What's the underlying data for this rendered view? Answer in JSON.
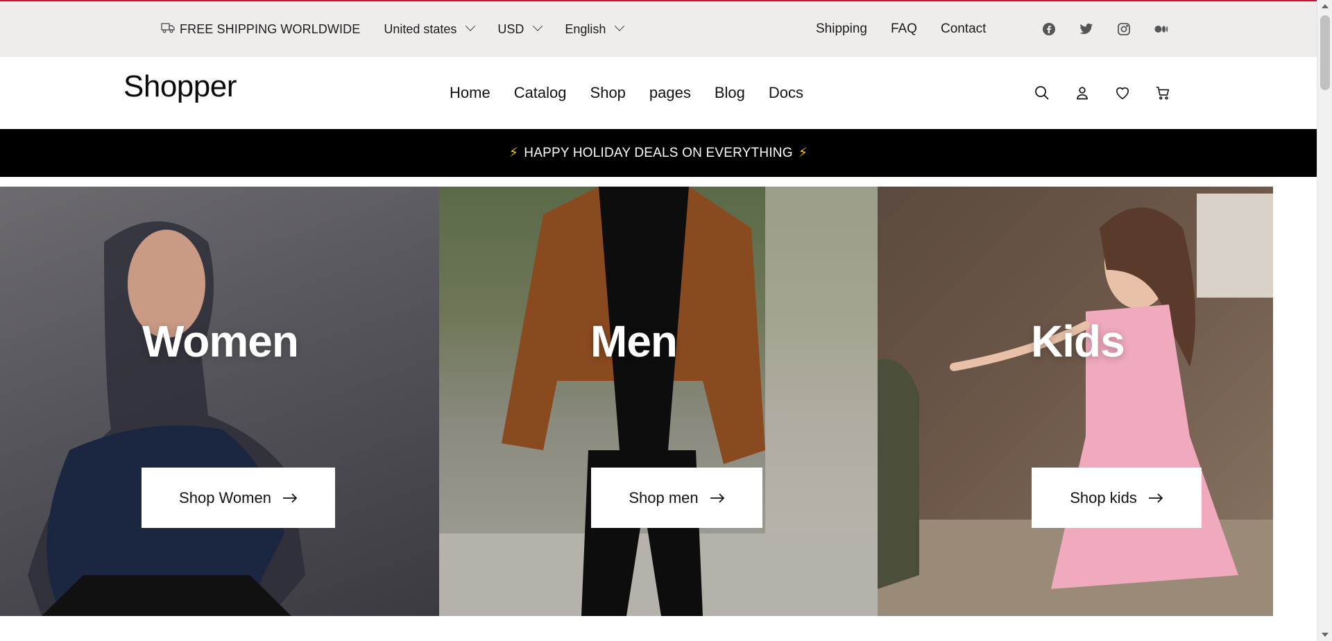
{
  "topbar": {
    "shipping_text": "FREE SHIPPING WORLDWIDE",
    "country": "United states",
    "currency": "USD",
    "language": "English",
    "links": [
      "Shipping",
      "FAQ",
      "Contact"
    ],
    "social_icons": [
      "facebook-icon",
      "twitter-icon",
      "instagram-icon",
      "medium-icon"
    ]
  },
  "header": {
    "logo": "Shopper",
    "nav": [
      "Home",
      "Catalog",
      "Shop",
      "pages",
      "Blog",
      "Docs"
    ],
    "icons": [
      "search-icon",
      "user-icon",
      "heart-icon",
      "cart-icon"
    ]
  },
  "promo": {
    "text": "HAPPY HOLIDAY DEALS ON EVERYTHING",
    "bolt": "⚡"
  },
  "categories": [
    {
      "title": "Women",
      "button": "Shop Women"
    },
    {
      "title": "Men",
      "button": "Shop men"
    },
    {
      "title": "Kids",
      "button": "Shop kids"
    }
  ],
  "colors": {
    "accent_line": "#c8102e",
    "topbar_bg": "#efedec",
    "promo_bg": "#000000",
    "bolt": "#f5c518"
  }
}
